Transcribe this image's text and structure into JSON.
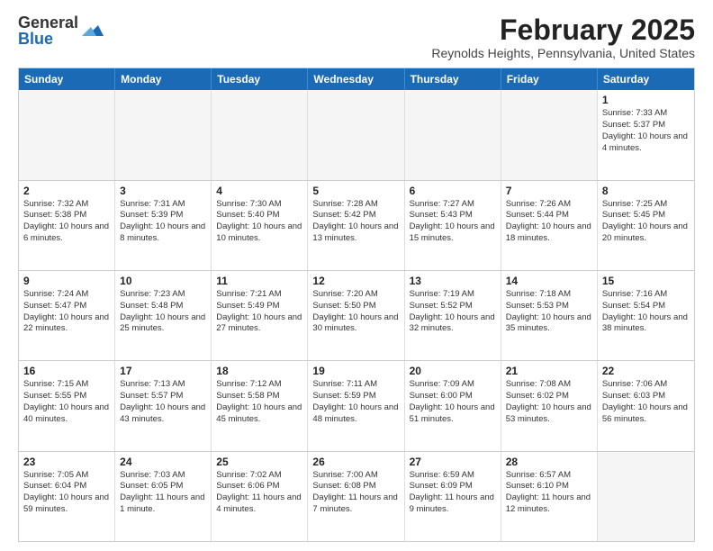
{
  "logo": {
    "general": "General",
    "blue": "Blue"
  },
  "title": "February 2025",
  "location": "Reynolds Heights, Pennsylvania, United States",
  "header_days": [
    "Sunday",
    "Monday",
    "Tuesday",
    "Wednesday",
    "Thursday",
    "Friday",
    "Saturday"
  ],
  "rows": [
    [
      {
        "day": "",
        "info": "",
        "empty": true
      },
      {
        "day": "",
        "info": "",
        "empty": true
      },
      {
        "day": "",
        "info": "",
        "empty": true
      },
      {
        "day": "",
        "info": "",
        "empty": true
      },
      {
        "day": "",
        "info": "",
        "empty": true
      },
      {
        "day": "",
        "info": "",
        "empty": true
      },
      {
        "day": "1",
        "info": "Sunrise: 7:33 AM\nSunset: 5:37 PM\nDaylight: 10 hours and 4 minutes."
      }
    ],
    [
      {
        "day": "2",
        "info": "Sunrise: 7:32 AM\nSunset: 5:38 PM\nDaylight: 10 hours and 6 minutes."
      },
      {
        "day": "3",
        "info": "Sunrise: 7:31 AM\nSunset: 5:39 PM\nDaylight: 10 hours and 8 minutes."
      },
      {
        "day": "4",
        "info": "Sunrise: 7:30 AM\nSunset: 5:40 PM\nDaylight: 10 hours and 10 minutes."
      },
      {
        "day": "5",
        "info": "Sunrise: 7:28 AM\nSunset: 5:42 PM\nDaylight: 10 hours and 13 minutes."
      },
      {
        "day": "6",
        "info": "Sunrise: 7:27 AM\nSunset: 5:43 PM\nDaylight: 10 hours and 15 minutes."
      },
      {
        "day": "7",
        "info": "Sunrise: 7:26 AM\nSunset: 5:44 PM\nDaylight: 10 hours and 18 minutes."
      },
      {
        "day": "8",
        "info": "Sunrise: 7:25 AM\nSunset: 5:45 PM\nDaylight: 10 hours and 20 minutes."
      }
    ],
    [
      {
        "day": "9",
        "info": "Sunrise: 7:24 AM\nSunset: 5:47 PM\nDaylight: 10 hours and 22 minutes."
      },
      {
        "day": "10",
        "info": "Sunrise: 7:23 AM\nSunset: 5:48 PM\nDaylight: 10 hours and 25 minutes."
      },
      {
        "day": "11",
        "info": "Sunrise: 7:21 AM\nSunset: 5:49 PM\nDaylight: 10 hours and 27 minutes."
      },
      {
        "day": "12",
        "info": "Sunrise: 7:20 AM\nSunset: 5:50 PM\nDaylight: 10 hours and 30 minutes."
      },
      {
        "day": "13",
        "info": "Sunrise: 7:19 AM\nSunset: 5:52 PM\nDaylight: 10 hours and 32 minutes."
      },
      {
        "day": "14",
        "info": "Sunrise: 7:18 AM\nSunset: 5:53 PM\nDaylight: 10 hours and 35 minutes."
      },
      {
        "day": "15",
        "info": "Sunrise: 7:16 AM\nSunset: 5:54 PM\nDaylight: 10 hours and 38 minutes."
      }
    ],
    [
      {
        "day": "16",
        "info": "Sunrise: 7:15 AM\nSunset: 5:55 PM\nDaylight: 10 hours and 40 minutes."
      },
      {
        "day": "17",
        "info": "Sunrise: 7:13 AM\nSunset: 5:57 PM\nDaylight: 10 hours and 43 minutes."
      },
      {
        "day": "18",
        "info": "Sunrise: 7:12 AM\nSunset: 5:58 PM\nDaylight: 10 hours and 45 minutes."
      },
      {
        "day": "19",
        "info": "Sunrise: 7:11 AM\nSunset: 5:59 PM\nDaylight: 10 hours and 48 minutes."
      },
      {
        "day": "20",
        "info": "Sunrise: 7:09 AM\nSunset: 6:00 PM\nDaylight: 10 hours and 51 minutes."
      },
      {
        "day": "21",
        "info": "Sunrise: 7:08 AM\nSunset: 6:02 PM\nDaylight: 10 hours and 53 minutes."
      },
      {
        "day": "22",
        "info": "Sunrise: 7:06 AM\nSunset: 6:03 PM\nDaylight: 10 hours and 56 minutes."
      }
    ],
    [
      {
        "day": "23",
        "info": "Sunrise: 7:05 AM\nSunset: 6:04 PM\nDaylight: 10 hours and 59 minutes."
      },
      {
        "day": "24",
        "info": "Sunrise: 7:03 AM\nSunset: 6:05 PM\nDaylight: 11 hours and 1 minute."
      },
      {
        "day": "25",
        "info": "Sunrise: 7:02 AM\nSunset: 6:06 PM\nDaylight: 11 hours and 4 minutes."
      },
      {
        "day": "26",
        "info": "Sunrise: 7:00 AM\nSunset: 6:08 PM\nDaylight: 11 hours and 7 minutes."
      },
      {
        "day": "27",
        "info": "Sunrise: 6:59 AM\nSunset: 6:09 PM\nDaylight: 11 hours and 9 minutes."
      },
      {
        "day": "28",
        "info": "Sunrise: 6:57 AM\nSunset: 6:10 PM\nDaylight: 11 hours and 12 minutes."
      },
      {
        "day": "",
        "info": "",
        "empty": true
      }
    ]
  ]
}
